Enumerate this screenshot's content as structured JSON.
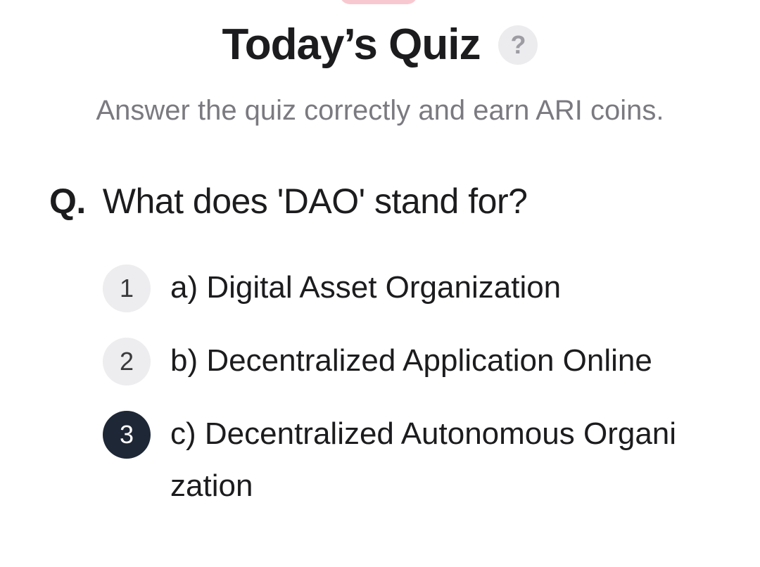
{
  "header": {
    "title": "Today’s Quiz",
    "help_icon": "?"
  },
  "subtitle": "Answer the quiz correctly and earn ARI coins.",
  "question": {
    "prefix": "Q.",
    "text": "What does 'DAO' stand for?"
  },
  "options": [
    {
      "number": "1",
      "text": "a) Digital Asset Organization",
      "selected": false
    },
    {
      "number": "2",
      "text": "b) Decentralized Application Online",
      "selected": false
    },
    {
      "number": "3",
      "text": "c) Decentralized Autonomous Organization",
      "selected": true
    }
  ],
  "colors": {
    "accent_pill": "#f8c8d0",
    "selected_badge": "#1e2736",
    "badge_bg": "#ededef",
    "subtitle_text": "#7a7a80"
  }
}
